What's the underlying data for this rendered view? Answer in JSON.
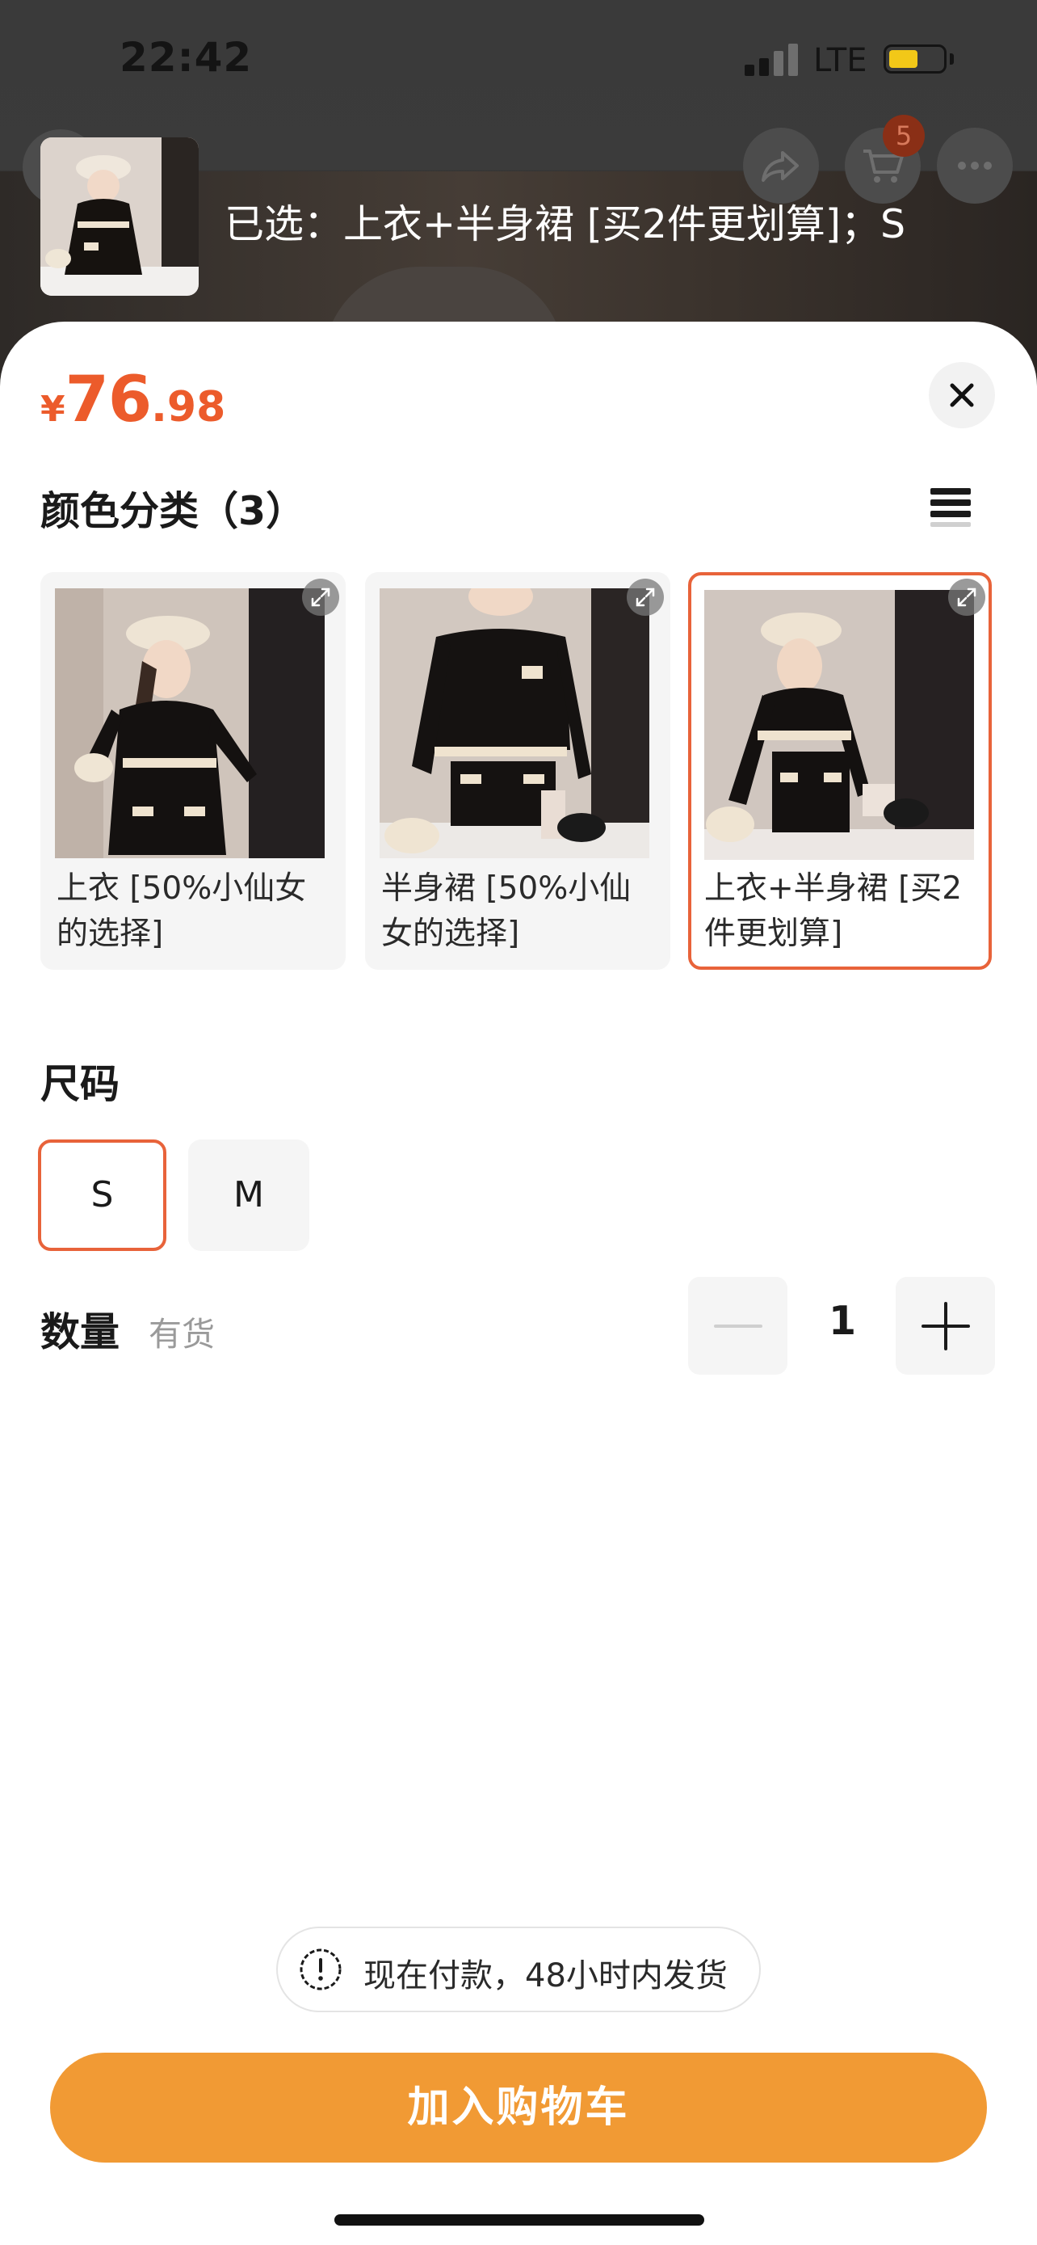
{
  "status_bar": {
    "time": "22:42",
    "network": "LTE",
    "battery_level": 0.55,
    "battery_color": "#f2c818"
  },
  "header": {
    "back_icon": "chevron-left-icon",
    "share_icon": "share-icon",
    "cart_icon": "cart-icon",
    "more_icon": "more-icon",
    "cart_badge": "5",
    "selected_text": "已选：上衣+半身裙 [买2件更划算]；S"
  },
  "price": {
    "currency": "¥",
    "integer": "76",
    "decimal": ".98",
    "color": "#ec5b2b"
  },
  "color_section": {
    "title": "颜色分类（3）",
    "options": [
      {
        "label": "上衣 [50%小仙女的选择]",
        "selected": false
      },
      {
        "label": "半身裙 [50%小仙女的选择]",
        "selected": false
      },
      {
        "label": "上衣+半身裙 [买2件更划算]",
        "selected": true
      }
    ],
    "selected_border_color": "#e8633a"
  },
  "size_section": {
    "title": "尺码",
    "options": [
      {
        "label": "S",
        "selected": true
      },
      {
        "label": "M",
        "selected": false
      }
    ]
  },
  "quantity_section": {
    "title": "数量",
    "stock_status": "有货",
    "value": "1"
  },
  "notice": {
    "icon": "exclamation-circle-icon",
    "text": "现在付款，48小时内发货"
  },
  "add_to_cart": {
    "label": "加入购物车",
    "color": "#f19a34"
  }
}
